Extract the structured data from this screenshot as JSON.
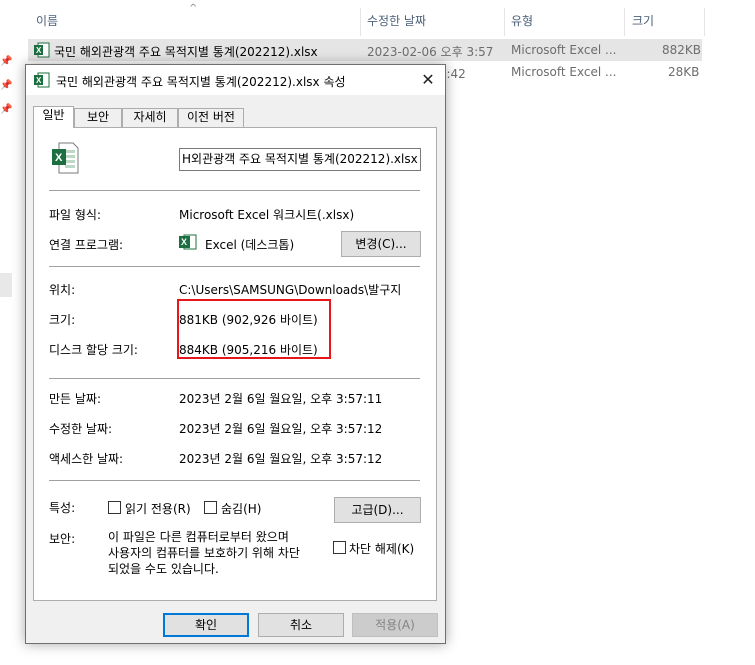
{
  "explorer": {
    "columns": {
      "name": "이름",
      "date": "수정한 날짜",
      "type": "유형",
      "size": "크기"
    },
    "sort_indicator": "^",
    "files": [
      {
        "name": "국민 해외관광객 주요 목적지별 통계(202212).xlsx",
        "date": "2023-02-06 오후 3:57",
        "type": "Microsoft Excel ...",
        "size": "882KB",
        "selected": true
      },
      {
        "name": "",
        "date": "전 7:42",
        "type": "Microsoft Excel ...",
        "size": "28KB",
        "selected": false
      }
    ]
  },
  "dialog": {
    "title": "국민 해외관광객 주요 목적지별 통계(202212).xlsx 속성",
    "close": "✕",
    "tabs": [
      "일반",
      "보안",
      "자세히",
      "이전 버전"
    ],
    "active_tab": "일반",
    "filename_value": "H외관광객 주요 목적지별 통계(202212).xlsx",
    "file_type_label": "파일 형식:",
    "file_type_value": "Microsoft Excel 워크시트(.xlsx)",
    "opens_with_label": "연결 프로그램:",
    "opens_with_value": "Excel (데스크톱)",
    "change_button": "변경(C)...",
    "location_label": "위치:",
    "location_value": "C:\\Users\\SAMSUNG\\Downloads\\발구지",
    "size_label": "크기:",
    "size_value": "881KB (902,926 바이트)",
    "size_on_disk_label": "디스크 할당 크기:",
    "size_on_disk_value": "884KB (905,216 바이트)",
    "created_label": "만든 날짜:",
    "created_value": "2023년 2월 6일 월요일, 오후 3:57:11",
    "modified_label": "수정한 날짜:",
    "modified_value": "2023년 2월 6일 월요일, 오후 3:57:12",
    "accessed_label": "액세스한 날짜:",
    "accessed_value": "2023년 2월 6일 월요일, 오후 3:57:12",
    "attributes_label": "특성:",
    "readonly_label": "읽기 전용(R)",
    "hidden_label": "숨김(H)",
    "advanced_button": "고급(D)...",
    "security_label": "보안:",
    "security_text": "이 파일은 다른 컴퓨터로부터 왔으며\n사용자의 컴퓨터를 보호하기 위해 차단\n되었을 수도 있습니다.",
    "unblock_label": "차단 해제(K)",
    "ok_button": "확인",
    "cancel_button": "취소",
    "apply_button": "적용(A)"
  },
  "colors": {
    "highlight_border": "#e8161b",
    "excel_green": "#1d6f42",
    "default_button_border": "#0078d7"
  }
}
